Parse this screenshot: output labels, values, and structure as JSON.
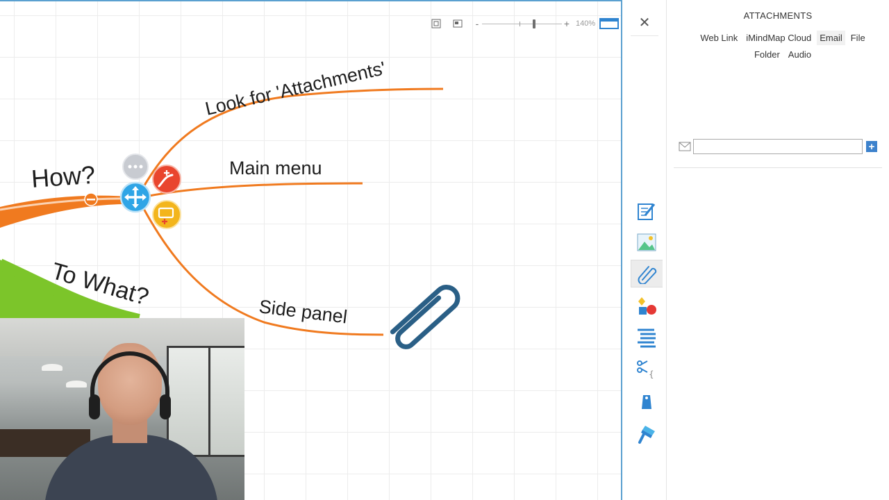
{
  "canvas": {
    "nodes": {
      "central_branch_label": "How?",
      "secondary_branch_label": "To What?",
      "sub_branches": [
        {
          "label": "Look for 'Attachments'"
        },
        {
          "label": "Main menu"
        },
        {
          "label": "Side panel"
        }
      ]
    },
    "toolbar": {
      "zoom_minus": "-",
      "zoom_plus": "+",
      "zoom_level": "140%",
      "zoom_fraction": 0.66
    },
    "colors": {
      "branch_orange": "#f07a1f",
      "branch_green": "#7cc52a",
      "clip_blue": "#2a5f86",
      "accent_blue": "#2f84d0"
    }
  },
  "rail": {
    "close_label": "✕",
    "buttons": [
      {
        "icon": "notes-icon"
      },
      {
        "icon": "image-icon"
      },
      {
        "icon": "attachments-icon",
        "active": true
      },
      {
        "icon": "shapes-icon"
      },
      {
        "icon": "list-icon"
      },
      {
        "icon": "clip-format-icon"
      },
      {
        "icon": "tag-icon"
      },
      {
        "icon": "paint-brush-icon"
      }
    ]
  },
  "panel": {
    "title": "ATTACHMENTS",
    "types": [
      {
        "label": "Web Link",
        "selected": false
      },
      {
        "label": "iMindMap Cloud",
        "selected": false
      },
      {
        "label": "Email",
        "selected": true
      },
      {
        "label": "File",
        "selected": false
      },
      {
        "label": "Folder",
        "selected": false
      },
      {
        "label": "Audio",
        "selected": false
      }
    ],
    "input": {
      "value": "",
      "placeholder": ""
    },
    "add_label": "+"
  }
}
